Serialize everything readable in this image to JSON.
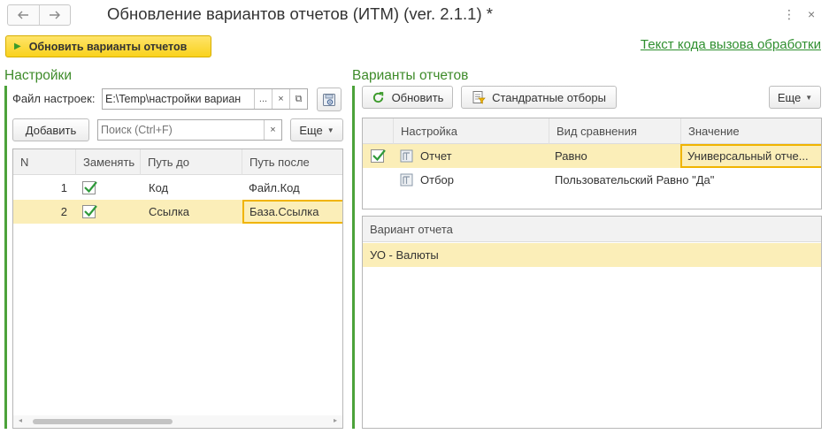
{
  "window": {
    "title": "Обновление вариантов отчетов (ИТМ) (ver. 2.1.1) *",
    "back_icon": "arrow-left-icon",
    "forward_icon": "arrow-right-icon",
    "menu_glyph": "⋮",
    "close_glyph": "×"
  },
  "toolbar": {
    "run_label": "Обновить варианты отчетов",
    "code_link": "Текст кода вызова обработки"
  },
  "settings": {
    "title": "Настройки",
    "file_label": "Файл настроек:",
    "file_value": "E:\\Temp\\настройки вариан",
    "choose_glyph": "...",
    "clear_glyph": "×",
    "open_glyph": "⧉",
    "add_label": "Добавить",
    "search_placeholder": "Поиск (Ctrl+F)",
    "search_clear": "×",
    "more_label": "Еще",
    "columns": [
      "N",
      "Заменять",
      "Путь до",
      "Путь после"
    ],
    "rows": [
      {
        "n": "1",
        "replace": true,
        "from": "Код",
        "to": "Файл.Код"
      },
      {
        "n": "2",
        "replace": true,
        "from": "Ссылка",
        "to": "База.Ссылка"
      }
    ],
    "selected_row": 1
  },
  "variants": {
    "title": "Варианты отчетов",
    "refresh_label": "Обновить",
    "standard_filters_label": "Стандратные отборы",
    "more_label": "Еще",
    "filter_columns": [
      "Настройка",
      "Вид сравнения",
      "Значение"
    ],
    "filter_rows": [
      {
        "checked": true,
        "setting": "Отчет",
        "comparison": "Равно",
        "value": "Универсальный отче..."
      },
      {
        "checked": false,
        "setting": "Отбор",
        "comparison": "Пользовательский Равно \"Да\"",
        "value": ""
      }
    ],
    "variant_column": "Вариант отчета",
    "variant_rows": [
      "УО - Валюты"
    ]
  },
  "colors": {
    "accent_green": "#4ca23a",
    "selection": "#fbeeb8",
    "button_yellow": "#f9d21d"
  }
}
